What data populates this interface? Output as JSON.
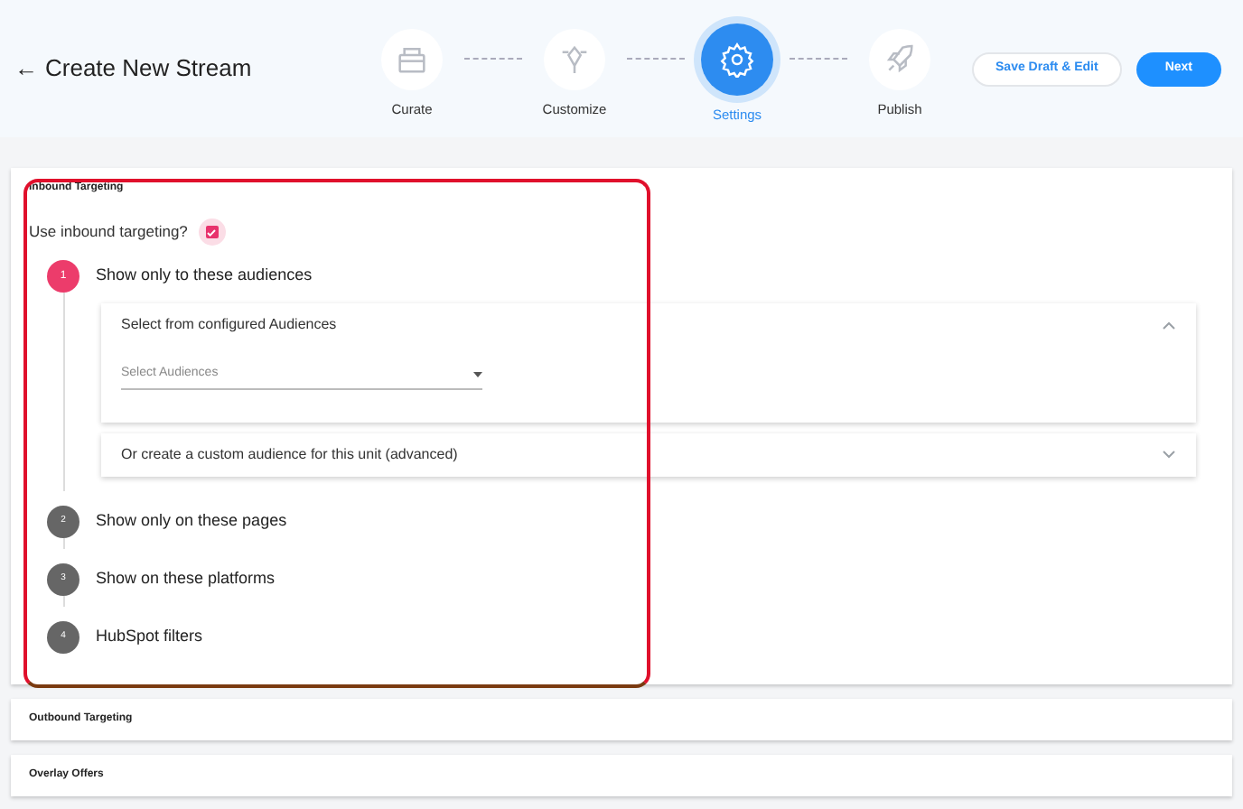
{
  "header": {
    "title": "Create New Stream",
    "back_icon": "←"
  },
  "stepper": [
    {
      "label": "Curate",
      "selected": false,
      "kind": "box"
    },
    {
      "label": "Customize",
      "selected": false,
      "kind": "pen"
    },
    {
      "label": "Settings",
      "selected": true,
      "kind": "gear"
    },
    {
      "label": "Publish",
      "selected": false,
      "kind": "rocket"
    }
  ],
  "buttons": {
    "save": "Save Draft & Edit",
    "next": "Next"
  },
  "sections": [
    {
      "title": "Inbound Targeting",
      "expanded": true
    },
    {
      "title": "Outbound Targeting",
      "expanded": false
    },
    {
      "title": "Overlay Offers",
      "expanded": false
    }
  ],
  "inbound": {
    "toggle_label": "Use inbound targeting?",
    "checked": true,
    "steps": [
      {
        "number": "1",
        "title": "Show only to these audiences",
        "selected": true
      },
      {
        "number": "2",
        "title": "Show only on these pages",
        "selected": false
      },
      {
        "number": "3",
        "title": "Show on these platforms",
        "selected": false
      },
      {
        "number": "4",
        "title": "HubSpot filters",
        "selected": false
      }
    ],
    "panels": [
      {
        "title": "Select from configured Audiences",
        "expanded": true,
        "placeholder": "Select Audiences"
      },
      {
        "title": "Or create a custom audience for this unit (advanced)",
        "expanded": false
      }
    ]
  },
  "highlight": {
    "on": true
  }
}
